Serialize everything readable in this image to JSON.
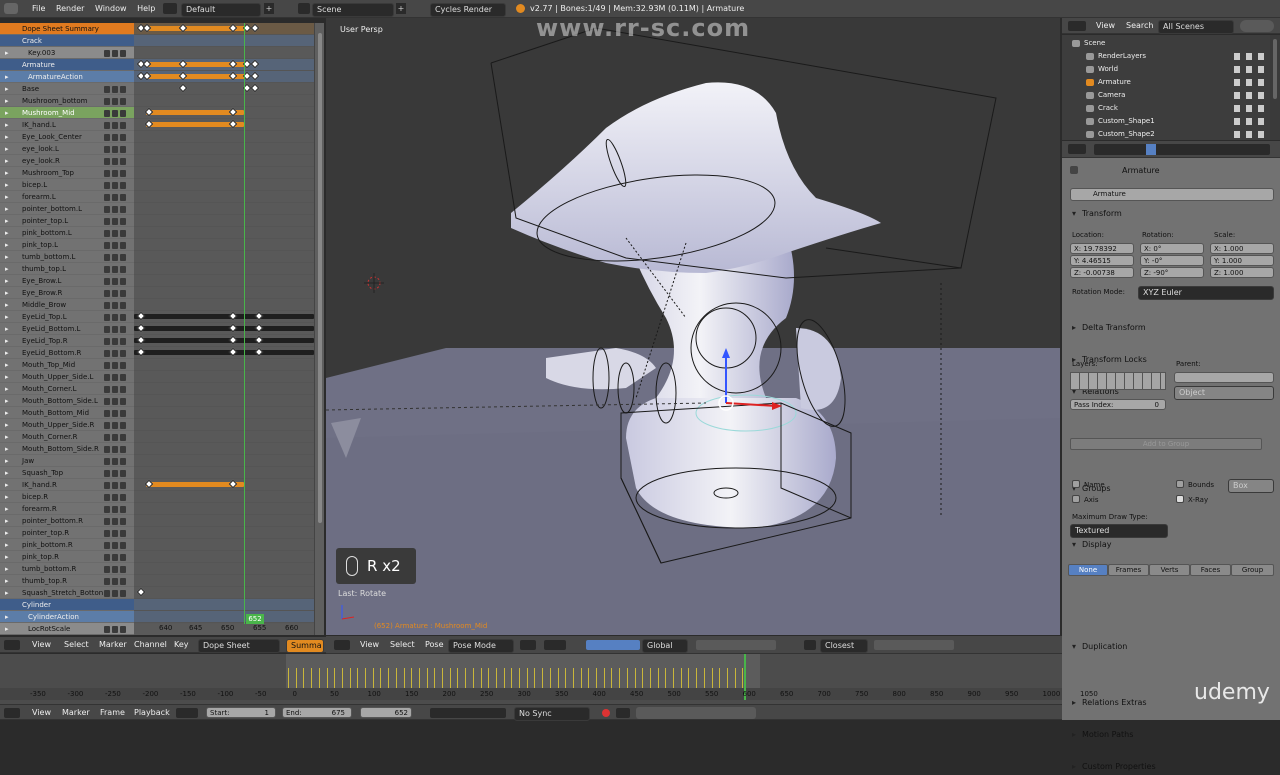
{
  "top_menu": {
    "items": [
      "File",
      "Render",
      "Window",
      "Help"
    ],
    "layout": "Default",
    "scene": "Scene",
    "engine": "Cycles Render",
    "stats": "v2.77 | Bones:1/49 | Mem:32.93M (0.11M) | Armature"
  },
  "watermark": "www.rr-sc.com",
  "dopesheet": {
    "channels": [
      {
        "label": "Dope Sheet Summary",
        "type": "summary"
      },
      {
        "label": "Crack",
        "type": "obj"
      },
      {
        "label": "Key.003",
        "type": "sub"
      },
      {
        "label": "Armature",
        "type": "obj"
      },
      {
        "label": "ArmatureAction",
        "type": "act"
      },
      {
        "label": "Base",
        "type": "bone"
      },
      {
        "label": "Mushroom_bottom",
        "type": "bone"
      },
      {
        "label": "Mushroom_Mid",
        "type": "sel"
      },
      {
        "label": "IK_hand.L",
        "type": "bone"
      },
      {
        "label": "Eye_Look_Center",
        "type": "bone"
      },
      {
        "label": "eye_look.L",
        "type": "bone"
      },
      {
        "label": "eye_look.R",
        "type": "bone"
      },
      {
        "label": "Mushroom_Top",
        "type": "bone"
      },
      {
        "label": "bicep.L",
        "type": "bone"
      },
      {
        "label": "forearm.L",
        "type": "bone"
      },
      {
        "label": "pointer_bottom.L",
        "type": "bone"
      },
      {
        "label": "pointer_top.L",
        "type": "bone"
      },
      {
        "label": "pink_bottom.L",
        "type": "bone"
      },
      {
        "label": "pink_top.L",
        "type": "bone"
      },
      {
        "label": "tumb_bottom.L",
        "type": "bone"
      },
      {
        "label": "thumb_top.L",
        "type": "bone"
      },
      {
        "label": "Eye_Brow.L",
        "type": "bone"
      },
      {
        "label": "Eye_Brow.R",
        "type": "bone"
      },
      {
        "label": "Middle_Brow",
        "type": "bone"
      },
      {
        "label": "EyeLid_Top.L",
        "type": "bone"
      },
      {
        "label": "EyeLid_Bottom.L",
        "type": "bone"
      },
      {
        "label": "EyeLid_Top.R",
        "type": "bone"
      },
      {
        "label": "EyeLid_Bottom.R",
        "type": "bone"
      },
      {
        "label": "Mouth_Top_Mid",
        "type": "bone"
      },
      {
        "label": "Mouth_Upper_Side.L",
        "type": "bone"
      },
      {
        "label": "Mouth_Corner.L",
        "type": "bone"
      },
      {
        "label": "Mouth_Bottom_Side.L",
        "type": "bone"
      },
      {
        "label": "Mouth_Bottom_Mid",
        "type": "bone"
      },
      {
        "label": "Mouth_Upper_Side.R",
        "type": "bone"
      },
      {
        "label": "Mouth_Corner.R",
        "type": "bone"
      },
      {
        "label": "Mouth_Bottom_Side.R",
        "type": "bone"
      },
      {
        "label": "Jaw",
        "type": "bone"
      },
      {
        "label": "Squash_Top",
        "type": "bone"
      },
      {
        "label": "IK_hand.R",
        "type": "bone"
      },
      {
        "label": "bicep.R",
        "type": "bone"
      },
      {
        "label": "forearm.R",
        "type": "bone"
      },
      {
        "label": "pointer_bottom.R",
        "type": "bone"
      },
      {
        "label": "pointer_top.R",
        "type": "bone"
      },
      {
        "label": "pink_bottom.R",
        "type": "bone"
      },
      {
        "label": "pink_top.R",
        "type": "bone"
      },
      {
        "label": "tumb_bottom.R",
        "type": "bone"
      },
      {
        "label": "thumb_top.R",
        "type": "bone"
      },
      {
        "label": "Squash_Stretch_Botton",
        "type": "bone"
      },
      {
        "label": "Cylinder",
        "type": "obj"
      },
      {
        "label": "CylinderAction",
        "type": "act"
      },
      {
        "label": "LocRotScale",
        "type": "sub"
      }
    ],
    "frame_ticks": [
      "640",
      "645",
      "650",
      "655",
      "660"
    ],
    "current_frame": "652",
    "header": {
      "items": [
        "View",
        "Select",
        "Marker",
        "Channel",
        "Key"
      ],
      "mode": "Dope Sheet",
      "summary": "Summa"
    }
  },
  "viewport": {
    "label": "User Persp",
    "key_overlay": "R x2",
    "last_op": "Last: Rotate",
    "status": "(652) Armature : Mushroom_Mid",
    "header": {
      "items": [
        "View",
        "Select",
        "Pose"
      ],
      "mode": "Pose Mode",
      "orientation": "Global",
      "snap": "Closest"
    }
  },
  "outliner": {
    "header": {
      "view": "View",
      "search": "Search",
      "filter": "All Scenes"
    },
    "items": [
      {
        "label": "Scene",
        "level": 0
      },
      {
        "label": "RenderLayers",
        "level": 1
      },
      {
        "label": "World",
        "level": 1
      },
      {
        "label": "Armature",
        "level": 1
      },
      {
        "label": "Camera",
        "level": 1
      },
      {
        "label": "Crack",
        "level": 1
      },
      {
        "label": "Custom_Shape1",
        "level": 1
      },
      {
        "label": "Custom_Shape2",
        "level": 1
      }
    ]
  },
  "properties": {
    "context": "Armature",
    "name": "Armature",
    "transform": {
      "title": "Transform",
      "location_label": "Location:",
      "rotation_label": "Rotation:",
      "scale_label": "Scale:",
      "location": [
        "X: 19.78392",
        "Y: 4.46515",
        "Z: -0.00738"
      ],
      "rotation": [
        "X: 0°",
        "Y: -0°",
        "Z: -90°"
      ],
      "scale": [
        "X: 1.000",
        "Y: 1.000",
        "Z: 1.000"
      ],
      "rotation_mode_label": "Rotation Mode:",
      "rotation_mode": "XYZ Euler"
    },
    "delta": "Delta Transform",
    "locks": "Transform Locks",
    "relations": {
      "title": "Relations",
      "layers": "Layers:",
      "parent": "Parent:",
      "parent_type": "Object",
      "pass_index": "Pass Index:",
      "pass_value": "0"
    },
    "groups": {
      "title": "Groups",
      "add": "Add to Group"
    },
    "display": {
      "title": "Display",
      "name": "Name",
      "axis": "Axis",
      "bounds": "Bounds",
      "bounds_type": "Box",
      "xray": "X-Ray",
      "max_draw_label": "Maximum Draw Type:",
      "max_draw": "Textured"
    },
    "duplication": {
      "title": "Duplication",
      "options": [
        "None",
        "Frames",
        "Verts",
        "Faces",
        "Group"
      ],
      "active": "None"
    },
    "extras": "Relations Extras",
    "motion": "Motion Paths",
    "custom": "Custom Properties"
  },
  "timeline": {
    "ticks": [
      "-350",
      "-300",
      "-250",
      "-200",
      "-150",
      "-100",
      "-50",
      "0",
      "50",
      "100",
      "150",
      "200",
      "250",
      "300",
      "350",
      "400",
      "450",
      "500",
      "550",
      "600",
      "650",
      "700",
      "750",
      "800",
      "850",
      "900",
      "950",
      "1000",
      "1050"
    ],
    "header": {
      "items": [
        "View",
        "Marker",
        "Frame",
        "Playback"
      ],
      "start": "Start:",
      "start_val": "1",
      "end": "End:",
      "end_val": "675",
      "current": "652",
      "sync": "No Sync"
    }
  },
  "brand": "udemy",
  "colors": {
    "key_orange": "#e28a20",
    "playhead": "#49b54a",
    "select_blue": "#5680c2"
  }
}
